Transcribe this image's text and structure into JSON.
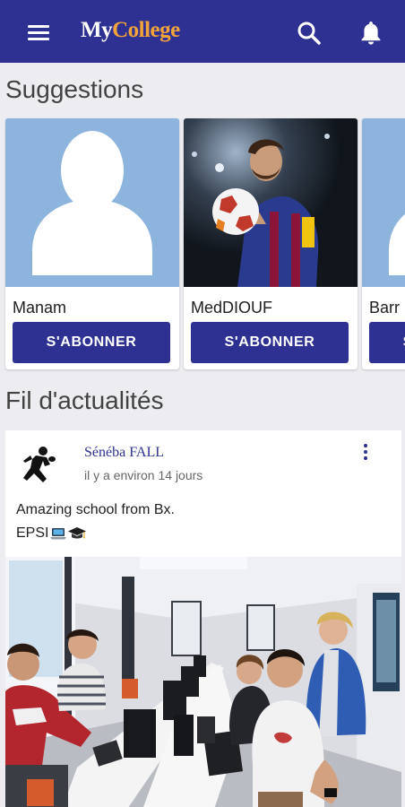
{
  "appbar": {
    "logo_part1": "My",
    "logo_part2": "College",
    "icons": [
      "menu-icon",
      "search-icon",
      "bell-icon"
    ],
    "color": "#2e3192",
    "accent": "#f2a33a"
  },
  "suggestions": {
    "title": "Suggestions",
    "cards": [
      {
        "name": "Manam",
        "button": "S'ABONNER",
        "photo": "default-avatar"
      },
      {
        "name": "MedDIOUF",
        "button": "S'ABONNER",
        "photo": "football-player"
      },
      {
        "name": "Barr",
        "button": "S'ABONNER",
        "photo": "default-avatar"
      }
    ]
  },
  "feed": {
    "title": "Fil d'actualités",
    "posts": [
      {
        "author": "Sénéba FALL",
        "time": "il y a environ 14 jours",
        "text_line1": "Amazing school from Bx.",
        "text_line2": "EPSI",
        "emojis": [
          "laptop-icon",
          "graduation-cap-icon"
        ],
        "image": "classroom-photo"
      }
    ]
  }
}
